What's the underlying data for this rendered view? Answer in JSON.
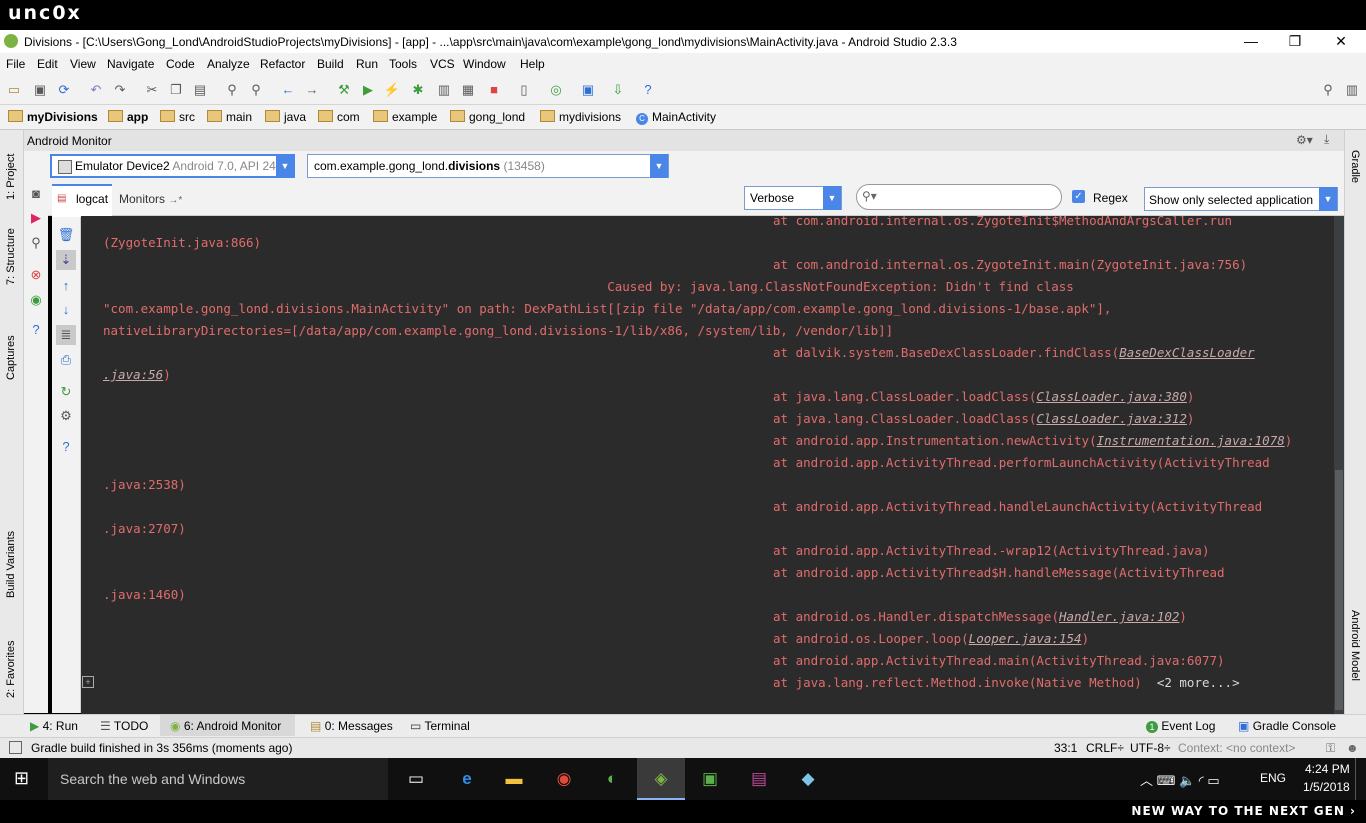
{
  "brand": {
    "logo": "unc0x",
    "slogan": "NEW WAY TO THE NEXT GEN ›"
  },
  "window": {
    "title": "Divisions - [C:\\Users\\Gong_Lond\\AndroidStudioProjects\\myDivisions] - [app] - ...\\app\\src\\main\\java\\com\\example\\gong_lond\\mydivisions\\MainActivity.java - Android Studio 2.3.3",
    "minimize": "—",
    "maximize": "❐",
    "close": "✕"
  },
  "menu": [
    "File",
    "Edit",
    "View",
    "Navigate",
    "Code",
    "Analyze",
    "Refactor",
    "Build",
    "Run",
    "Tools",
    "VCS",
    "Window",
    "Help"
  ],
  "breadcrumb": [
    "myDivisions",
    "app",
    "src",
    "main",
    "java",
    "com",
    "example",
    "gong_lond",
    "mydivisions",
    "MainActivity"
  ],
  "monitor": {
    "title": "Android Monitor",
    "device_name": "Emulator Device2",
    "device_detail": "Android 7.0, API 24",
    "process_prefix": "com.example.gong_lond.",
    "process_bold": "divisions",
    "process_pid": "(13458)",
    "tab_logcat": "logcat",
    "tab_monitors": "Monitors",
    "tab_monitors_suffix": "→*",
    "level": "Verbose",
    "search_placeholder": "",
    "regex_label": "Regex",
    "regex_checked": true,
    "filter": "Show only selected application"
  },
  "log": [
    {
      "indent": true,
      "text": "at com.android.internal.os.ZygoteInit$MethodAndArgsCaller.run"
    },
    {
      "indent": false,
      "text": "(ZygoteInit.java:866)"
    },
    {
      "indent": true,
      "text": "at com.android.internal.os.ZygoteInit.main(ZygoteInit.java:756)"
    },
    {
      "indent": false,
      "text": "                                                                   Caused by: java.lang.ClassNotFoundException: Didn't find class"
    },
    {
      "indent": false,
      "text": "\"com.example.gong_lond.divisions.MainActivity\" on path: DexPathList[[zip file \"/data/app/com.example.gong_lond.divisions-1/base.apk\"],"
    },
    {
      "indent": false,
      "text": "nativeLibraryDirectories=[/data/app/com.example.gong_lond.divisions-1/lib/x86, /system/lib, /vendor/lib]]"
    },
    {
      "indent": true,
      "text": "at dalvik.system.BaseDexClassLoader.findClass(",
      "link": "BaseDexClassLoader"
    },
    {
      "indent": false,
      "text": "",
      "link": ".java:56",
      "after": ")"
    },
    {
      "indent": true,
      "text": "at java.lang.ClassLoader.loadClass(",
      "link": "ClassLoader.java:380",
      "after": ")"
    },
    {
      "indent": true,
      "text": "at java.lang.ClassLoader.loadClass(",
      "link": "ClassLoader.java:312",
      "after": ")"
    },
    {
      "indent": true,
      "text": "at android.app.Instrumentation.newActivity(",
      "link": "Instrumentation.java:1078",
      "after": ")"
    },
    {
      "indent": true,
      "text": "at android.app.ActivityThread.performLaunchActivity(ActivityThread"
    },
    {
      "indent": false,
      "text": ".java:2538)"
    },
    {
      "indent": true,
      "text": "at android.app.ActivityThread.handleLaunchActivity(ActivityThread"
    },
    {
      "indent": false,
      "text": ".java:2707)"
    },
    {
      "indent": true,
      "text": "at android.app.ActivityThread.-wrap12(ActivityThread.java)"
    },
    {
      "indent": true,
      "text": "at android.app.ActivityThread$H.handleMessage(ActivityThread"
    },
    {
      "indent": false,
      "text": ".java:1460)"
    },
    {
      "indent": true,
      "text": "at android.os.Handler.dispatchMessage(",
      "link": "Handler.java:102",
      "after": ")"
    },
    {
      "indent": true,
      "text": "at android.os.Looper.loop(",
      "link": "Looper.java:154",
      "after": ")"
    },
    {
      "indent": true,
      "text": "at android.app.ActivityThread.main(ActivityThread.java:6077)"
    },
    {
      "indent": true,
      "text": "at java.lang.reflect.Method.invoke(Native Method)  ",
      "more": "<2 more...>"
    }
  ],
  "bottom_tabs": {
    "run": "4: Run",
    "todo": "TODO",
    "android_monitor": "6: Android Monitor",
    "messages": "0: Messages",
    "terminal": "Terminal",
    "event_log": "Event Log",
    "event_count": "1",
    "gradle_console": "Gradle Console"
  },
  "left_strip": {
    "project": "1: Project",
    "structure": "7: Structure",
    "captures": "Captures",
    "build_variants": "Build Variants",
    "favorites": "2: Favorites"
  },
  "right_strip": {
    "gradle": "Gradle",
    "android_model": "Android Model"
  },
  "status": {
    "message": "Gradle build finished in 3s 356ms (moments ago)",
    "position": "33:1",
    "line_sep": "CRLF÷",
    "encoding": "UTF-8÷",
    "context": "Context: <no context>"
  },
  "taskbar": {
    "search_placeholder": "Search the web and Windows",
    "time": "4:24 PM",
    "date": "1/5/2018",
    "lang": "ENG"
  },
  "colors": {
    "log_text": "#e06c6c",
    "log_bg": "#2b2b2b",
    "accent": "#4a86e8"
  }
}
